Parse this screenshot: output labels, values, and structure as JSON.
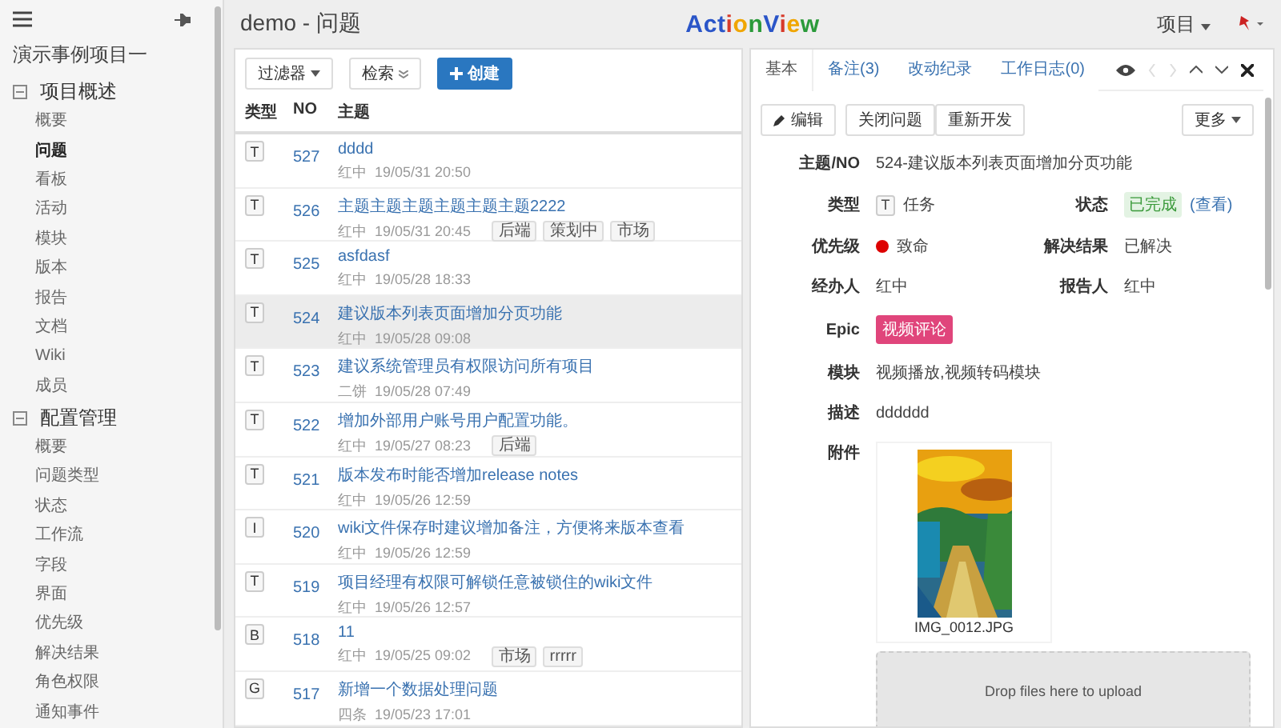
{
  "sidebar": {
    "project": "演示事例项目一",
    "sections": [
      {
        "title": "项目概述",
        "expanded": true,
        "items": [
          {
            "label": "概要",
            "selected": false
          },
          {
            "label": "问题",
            "selected": true
          },
          {
            "label": "看板",
            "selected": false
          },
          {
            "label": "活动",
            "selected": false
          },
          {
            "label": "模块",
            "selected": false
          },
          {
            "label": "版本",
            "selected": false
          },
          {
            "label": "报告",
            "selected": false
          },
          {
            "label": "文档",
            "selected": false
          },
          {
            "label": "Wiki",
            "selected": false
          },
          {
            "label": "成员",
            "selected": false
          }
        ]
      },
      {
        "title": "配置管理",
        "expanded": true,
        "items": [
          {
            "label": "概要",
            "selected": false
          },
          {
            "label": "问题类型",
            "selected": false
          },
          {
            "label": "状态",
            "selected": false
          },
          {
            "label": "工作流",
            "selected": false
          },
          {
            "label": "字段",
            "selected": false
          },
          {
            "label": "界面",
            "selected": false
          },
          {
            "label": "优先级",
            "selected": false
          },
          {
            "label": "解决结果",
            "selected": false
          },
          {
            "label": "角色权限",
            "selected": false
          },
          {
            "label": "通知事件",
            "selected": false
          }
        ]
      }
    ]
  },
  "header": {
    "title": "demo - 问题",
    "logo": "ActionView",
    "menu": "项目"
  },
  "toolbar": {
    "filter": "过滤器",
    "search": "检索",
    "create": "创建"
  },
  "table": {
    "columns": [
      "类型",
      "NO",
      "主题"
    ],
    "rows": [
      {
        "type": "T",
        "no": "527",
        "title": "dddd",
        "meta": "红中  19/05/31 20:50",
        "tags": [],
        "selected": false
      },
      {
        "type": "T",
        "no": "526",
        "title": "主题主题主题主题主题主题2222",
        "meta": "红中  19/05/31 20:45",
        "tags": [
          "后端",
          "策划中",
          "市场"
        ],
        "selected": false
      },
      {
        "type": "T",
        "no": "525",
        "title": "asfdasf",
        "meta": "红中  19/05/28 18:33",
        "tags": [],
        "selected": false
      },
      {
        "type": "T",
        "no": "524",
        "title": "建议版本列表页面增加分页功能",
        "meta": "红中  19/05/28 09:08",
        "tags": [],
        "selected": true
      },
      {
        "type": "T",
        "no": "523",
        "title": "建议系统管理员有权限访问所有项目",
        "meta": "二饼  19/05/28 07:49",
        "tags": [],
        "selected": false
      },
      {
        "type": "T",
        "no": "522",
        "title": "增加外部用户账号用户配置功能。",
        "meta": "红中  19/05/27 08:23",
        "tags": [
          "后端"
        ],
        "selected": false
      },
      {
        "type": "T",
        "no": "521",
        "title": "版本发布时能否增加release notes",
        "meta": "红中  19/05/26 12:59",
        "tags": [],
        "selected": false
      },
      {
        "type": "I",
        "no": "520",
        "title": "wiki文件保存时建议增加备注，方便将来版本查看",
        "meta": "红中  19/05/26 12:59",
        "tags": [],
        "selected": false
      },
      {
        "type": "T",
        "no": "519",
        "title": "项目经理有权限可解锁任意被锁住的wiki文件",
        "meta": "红中  19/05/26 12:57",
        "tags": [],
        "selected": false
      },
      {
        "type": "B",
        "no": "518",
        "title": "11",
        "meta": "红中  19/05/25 09:02",
        "tags": [
          "市场",
          "rrrrr"
        ],
        "selected": false
      },
      {
        "type": "G",
        "no": "517",
        "title": "新增一个数据处理问题",
        "meta": "四条  19/05/23 17:01",
        "tags": [],
        "selected": false
      }
    ]
  },
  "detail": {
    "tabs": [
      {
        "label": "基本",
        "selected": true
      },
      {
        "label": "备注(3)",
        "selected": false
      },
      {
        "label": "改动纪录",
        "selected": false
      },
      {
        "label": "工作日志(0)",
        "selected": false
      }
    ],
    "actions": [
      "编辑",
      "关闭问题",
      "重新开发"
    ],
    "more": "更多",
    "subject_label": "主题/NO",
    "subject": "524-建议版本列表页面增加分页功能",
    "type_label": "类型",
    "type_badge": "T",
    "type": "任务",
    "status_label": "状态",
    "status": "已完成",
    "status_link": "(查看)",
    "priority_label": "优先级",
    "priority": "致命",
    "resolution_label": "解决结果",
    "resolution": "已解决",
    "assignee_label": "经办人",
    "assignee": "红中",
    "reporter_label": "报告人",
    "reporter": "红中",
    "epic_label": "Epic",
    "epic": "视频评论",
    "module_label": "模块",
    "module": "视频播放,视频转码模块",
    "desc_label": "描述",
    "desc": "dddddd",
    "attach_label": "附件",
    "attachment": {
      "kind": "picture",
      "name": "IMG_0012.JPG"
    },
    "dropzone": "Drop files here to upload"
  }
}
